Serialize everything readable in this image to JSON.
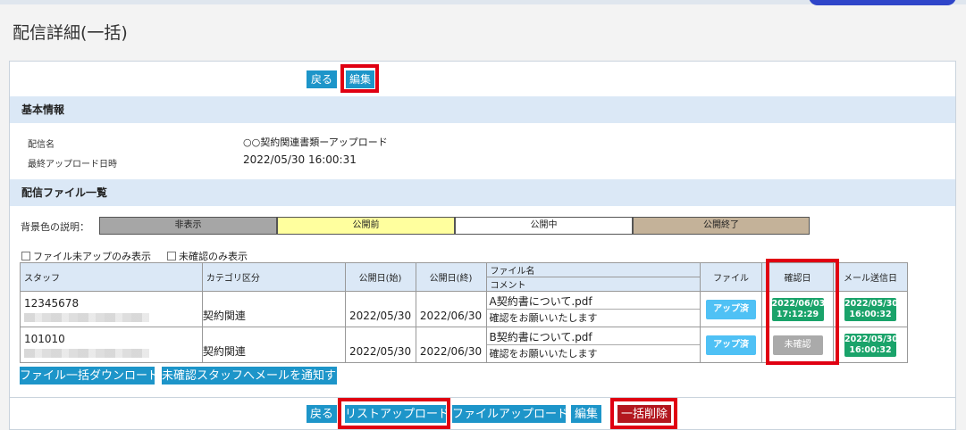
{
  "page": {
    "title": "配信詳細(一括)"
  },
  "top_actions": {
    "back": "戻る",
    "edit": "編集"
  },
  "basic_info": {
    "heading": "基本情報",
    "fields": [
      {
        "label": "配信名",
        "value": "○○契約関連書類ーアップロード"
      },
      {
        "label": "最終アップロード日時",
        "value": "2022/05/30 16:00:31"
      }
    ]
  },
  "file_list": {
    "heading": "配信ファイル一覧",
    "legend_label": "背景色の説明：",
    "legend": [
      {
        "label": "非表示",
        "color": "#a6a6a6"
      },
      {
        "label": "公開前",
        "color": "#ffff9e"
      },
      {
        "label": "公開中",
        "color": "#ffffff"
      },
      {
        "label": "公開終了",
        "color": "#c4b299"
      }
    ],
    "filters": {
      "only_not_uploaded": "ファイル未アップのみ表示",
      "only_unconfirmed": "未確認のみ表示"
    },
    "columns": {
      "staff": "スタッフ",
      "category": "カテゴリ区分",
      "publish_start": "公開日(始)",
      "publish_end": "公開日(終)",
      "file_name": "ファイル名",
      "comment": "コメント",
      "file": "ファイル",
      "confirmed_date": "確認日",
      "mail_sent_date": "メール送信日"
    },
    "rows": [
      {
        "staff_id": "12345678",
        "category": "契約関連",
        "publish_start": "2022/05/30",
        "publish_end": "2022/06/30",
        "file_name": "A契約書について.pdf",
        "comment": "確認をお願いいたします",
        "file_status": "アップ済",
        "confirmed_date": "2022/06/03",
        "confirmed_time": "17:12:29",
        "mail_date": "2022/05/30",
        "mail_time": "16:00:32"
      },
      {
        "staff_id": "101010",
        "category": "契約関連",
        "publish_start": "2022/05/30",
        "publish_end": "2022/06/30",
        "file_name": "B契約書について.pdf",
        "comment": "確認をお願いいたします",
        "file_status": "アップ済",
        "confirmed_status": "未確認",
        "mail_date": "2022/05/30",
        "mail_time": "16:00:32"
      }
    ],
    "actions": {
      "bulk_download": "ファイル一括ダウンロード",
      "notify_unconfirmed": "未確認スタッフへメールを通知する"
    }
  },
  "bottom_actions": {
    "back": "戻る",
    "list_upload": "リストアップロード",
    "file_upload": "ファイルアップロード",
    "edit": "編集",
    "bulk_delete": "一括削除"
  },
  "colors": {
    "accent": "#1d95c9",
    "highlight": "#e00012",
    "confirmed": "#1aa36a",
    "delete": "#b3171e",
    "header_bg": "#dbe8f6"
  }
}
